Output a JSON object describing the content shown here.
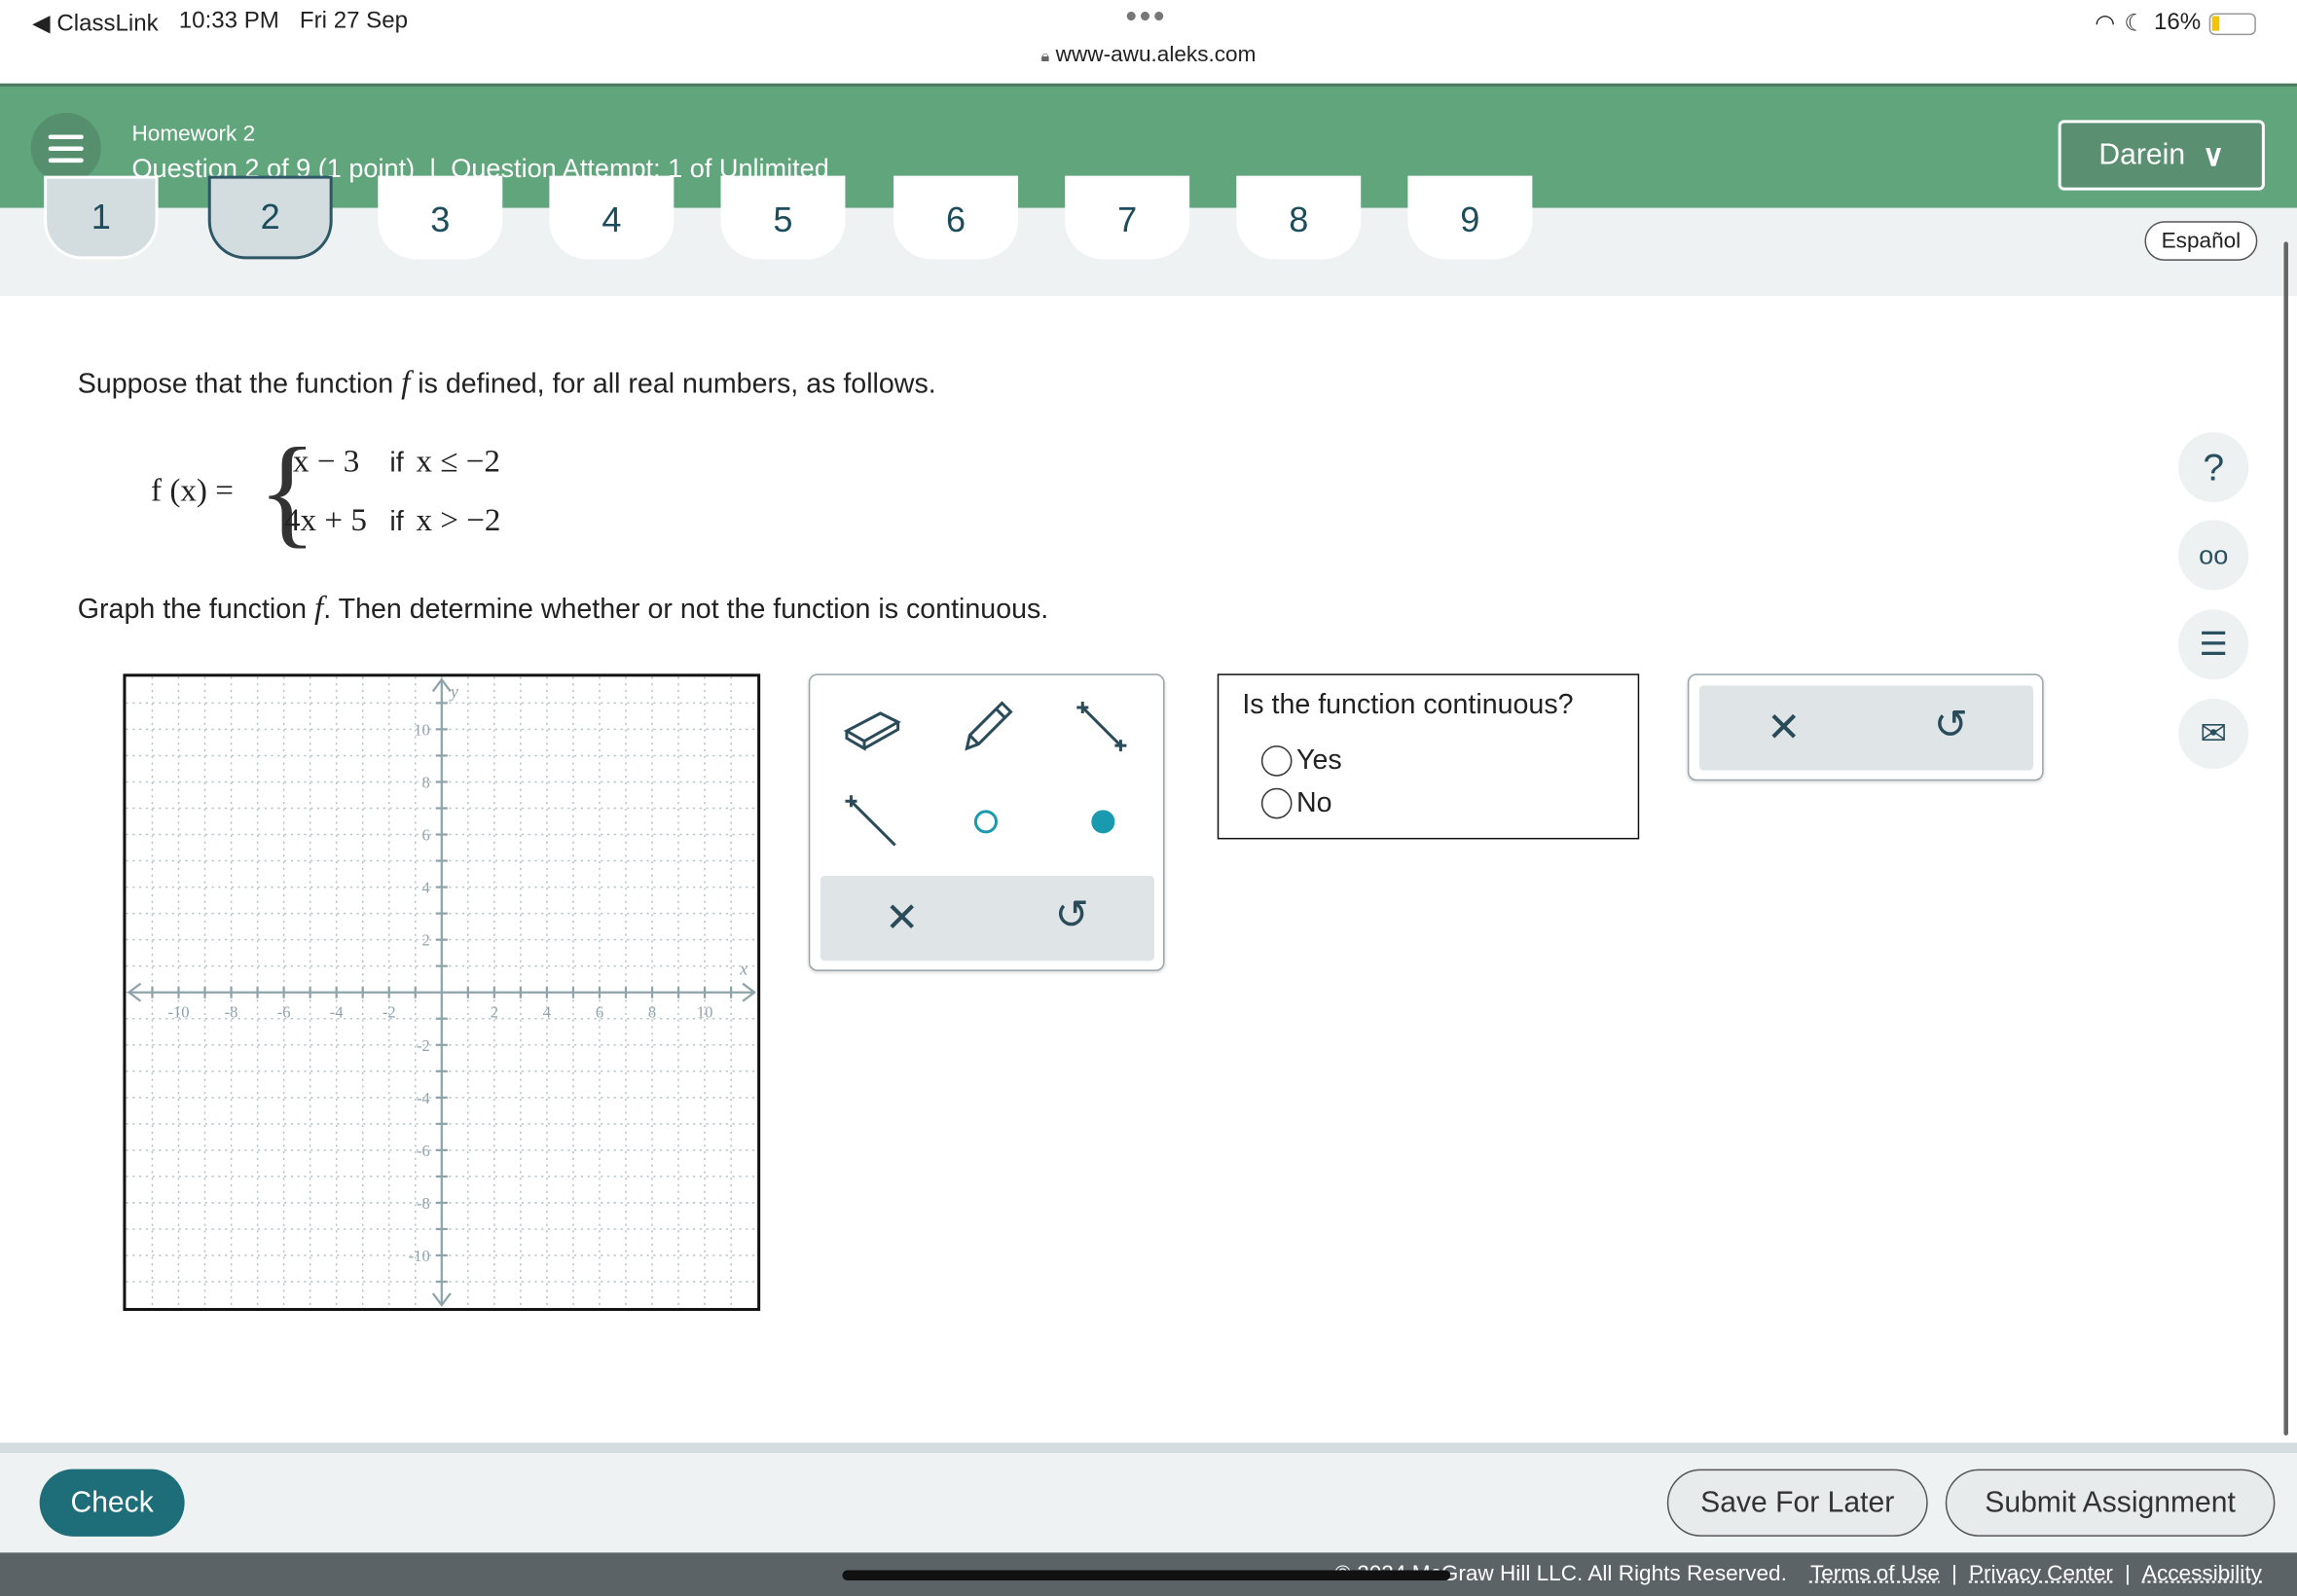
{
  "status_bar": {
    "back_app": "ClassLink",
    "time": "10:33 PM",
    "date": "Fri 27 Sep",
    "url": "www-awu.aleks.com",
    "battery": "16%"
  },
  "header": {
    "assignment": "Homework 2",
    "question_info": "Question 2 of 9 (1 point)",
    "separator": "|",
    "attempt": "Question Attempt: 1 of Unlimited",
    "user": "Darein",
    "color": "#60a57c"
  },
  "question_tabs": [
    {
      "label": "1",
      "state": "visited"
    },
    {
      "label": "2",
      "state": "current"
    },
    {
      "label": "3"
    },
    {
      "label": "4"
    },
    {
      "label": "5"
    },
    {
      "label": "6"
    },
    {
      "label": "7"
    },
    {
      "label": "8"
    },
    {
      "label": "9"
    }
  ],
  "language_button": "Español",
  "problem": {
    "intro_a": "Suppose that the function ",
    "f": "f",
    "intro_b": " is defined, for all real numbers, as follows.",
    "lhs": "f (x) =",
    "cases": [
      {
        "expr": "x − 3",
        "cond_word": "if",
        "cond": "x ≤ −2"
      },
      {
        "expr": "4x + 5",
        "cond_word": "if",
        "cond": "x > −2"
      }
    ],
    "instruction_a": "Graph the function ",
    "instruction_b": ". Then determine whether or not the function is continuous."
  },
  "graph": {
    "x_label": "x",
    "y_label": "y",
    "xmin": -12,
    "xmax": 12,
    "ymin": -12,
    "ymax": 12,
    "tick_labels": [
      -10,
      -8,
      -6,
      -4,
      -2,
      2,
      4,
      6,
      8,
      10
    ],
    "grid": true
  },
  "tools": [
    "eraser-icon",
    "pencil-icon",
    "segment-icon",
    "ray-icon",
    "open-circle-icon",
    "closed-circle-icon"
  ],
  "continuity": {
    "question": "Is the function continuous?",
    "options": [
      "Yes",
      "No"
    ],
    "selected": null
  },
  "footer": {
    "check": "Check",
    "save": "Save For Later",
    "submit": "Submit Assignment",
    "copyright": "© 2024 McGraw Hill LLC. All Rights Reserved.",
    "links": [
      "Terms of Use",
      "Privacy Center",
      "Accessibility"
    ],
    "link_sep": "|"
  },
  "colors": {
    "check": "#1e6e7a",
    "accent": "#1a9aae"
  }
}
